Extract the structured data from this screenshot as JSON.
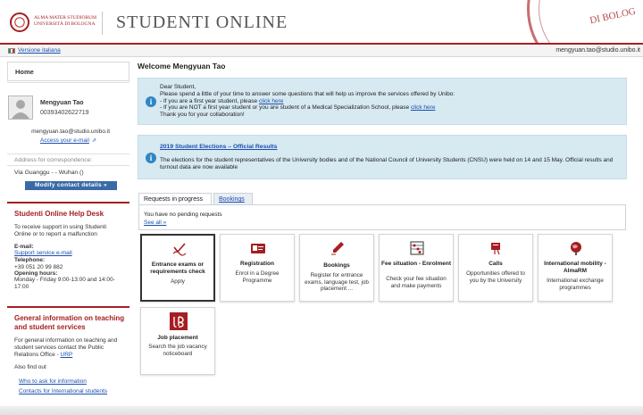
{
  "header": {
    "logo_line1": "ALMA MATER STUDIORUM",
    "logo_line2": "UNIVERSITÀ DI BOLOGNA",
    "app_title": "STUDENTI ONLINE",
    "seal_text": "DI BOLOG"
  },
  "topbar": {
    "language_link": "Versione italiana",
    "user_email": "mengyuan.tao@studio.unibo.it"
  },
  "sidebar": {
    "home": "Home",
    "profile": {
      "name": "Mengyuan Tao",
      "id": "00393402622719",
      "email": "mengyuan.tao@studio.unibo.it",
      "email_link": "Access your e-mail"
    },
    "address_label": "Address for correspondence:",
    "address_value": "Via Guanggu - - Wuhan ()",
    "modify_button": "Modify contact details »",
    "helpdesk": {
      "title": "Studenti Online Help Desk",
      "intro": "To receive support in using Studenti Online or to report a malfunction",
      "email_label": "E-mail:",
      "email_link": "Support service e-mail",
      "phone_label": "Telephone:",
      "phone": "+39 051 20 99 882",
      "hours_label": "Opening hours:",
      "hours": "Monday - Friday 9:00-13:00 and 14:00-17:00"
    },
    "general": {
      "title": "General information on teaching and student services",
      "text": "For general information on teaching and student services contact the Public Relations Office -",
      "urp_link": "URP",
      "also": "Also find out",
      "link1": "Who to ask for information",
      "link2": "Contacts for International students"
    }
  },
  "main": {
    "welcome": "Welcome Mengyuan Tao",
    "survey": {
      "line1": "Dear Student,",
      "line2": "Please spend a little of your time to answer some questions that will help us improve the services offered by Unibo:",
      "line3": "- If you are a first year student, please",
      "line3_link": "click here",
      "line4": "- If you are NOT a first year student or you are student of a Medical Specialization School, please",
      "line4_link": "click here",
      "line5": "Thank you for your collaboration!"
    },
    "elections": {
      "title": "2019 Student Elections – Official Results",
      "text": "The elections for the student representatives of the University bodies and of the National Council of University Students (CNSU) were held on 14 and 15 May. Official results and turnout data are now available"
    },
    "tabs": [
      "Requests in progress",
      "Bookings"
    ],
    "pending_text": "You have no pending requests",
    "see_all": "See all »",
    "tiles": [
      {
        "title": "Entrance exams or requirements check",
        "desc": "Apply",
        "icon": "signature-check-icon"
      },
      {
        "title": "Registration",
        "desc": "Enrol in a Degree Programme",
        "icon": "registration-card-icon"
      },
      {
        "title": "Bookings",
        "desc": "Register for entrance exams, language test, job placement ...",
        "icon": "pen-icon"
      },
      {
        "title": "Fee situation - Enrolment",
        "desc": "Check your fee situation and make payments",
        "icon": "abacus-icon"
      },
      {
        "title": "Calls",
        "desc": "Opportunities offered to you by the University",
        "icon": "calls-icon"
      },
      {
        "title": "International mobility - AlmaRM",
        "desc": "International exchange programmes",
        "icon": "globe-icon"
      },
      {
        "title": "Job placement",
        "desc": "Search the job vacancy noticeboard",
        "icon": "job-icon"
      }
    ]
  },
  "colors": {
    "brand_red": "#a51e22",
    "info_bg": "#d7e9f1",
    "link_blue": "#1a4fb0",
    "button_blue": "#3a6aa6"
  }
}
